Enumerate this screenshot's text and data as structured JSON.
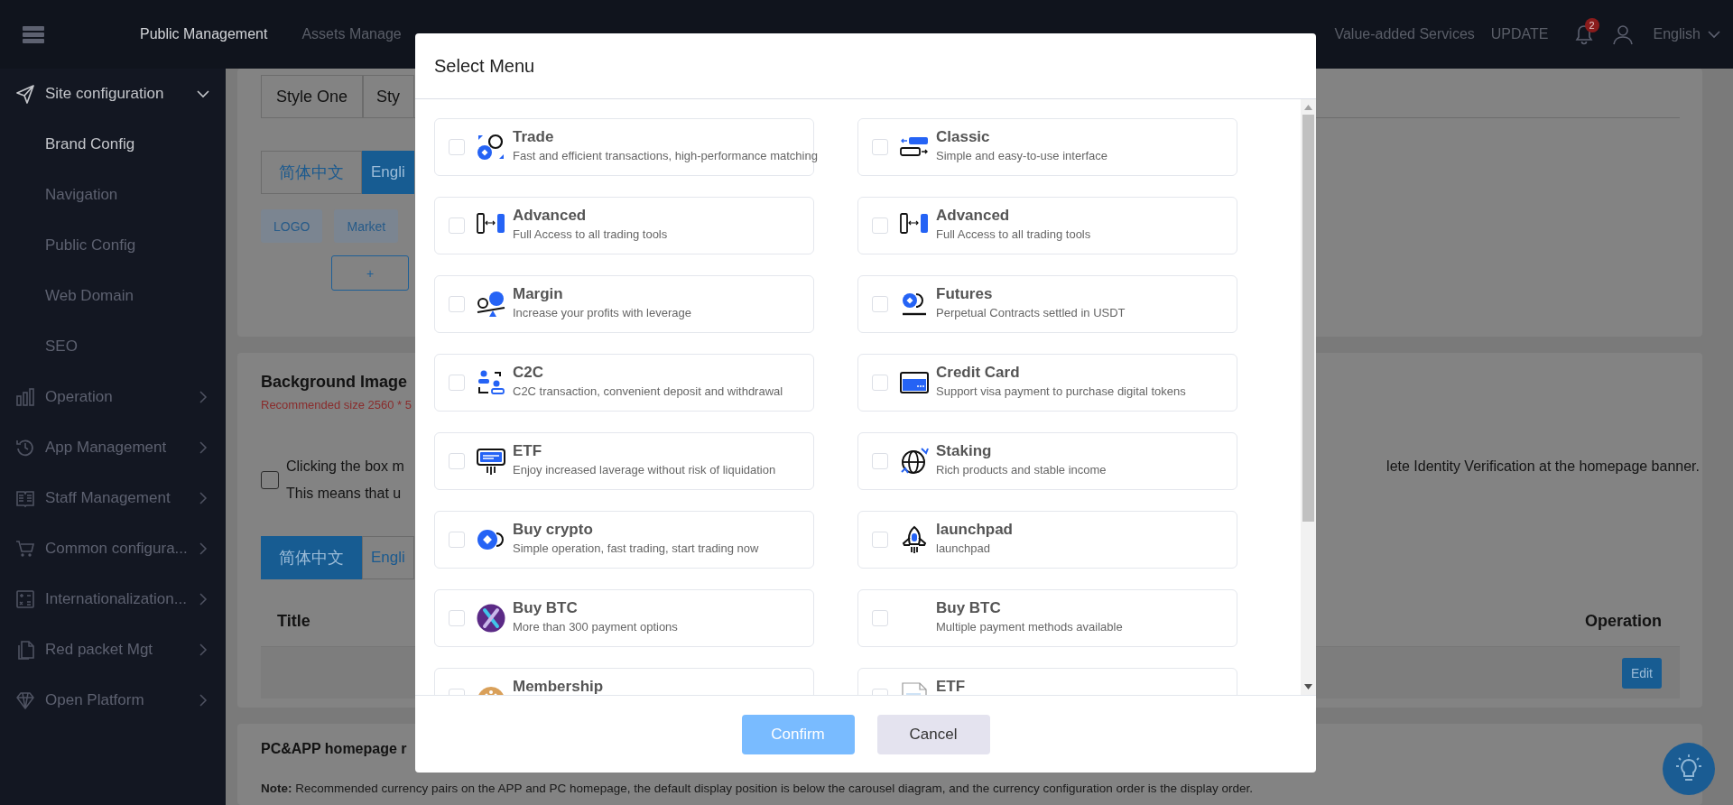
{
  "top_bar": {
    "nav": [
      {
        "label": "Public Management",
        "selected": true
      },
      {
        "label": "Assets Manage",
        "selected": false
      },
      {
        "label": "Value-added Services",
        "selected": false
      }
    ],
    "update_link": "UPDATE",
    "notification_count": "2",
    "language": "English"
  },
  "sidebar": {
    "items": [
      {
        "label": "Site configuration",
        "selected": false,
        "expanded": true,
        "children": [
          {
            "label": "Brand Config",
            "selected": true
          },
          {
            "label": "Navigation",
            "selected": false
          },
          {
            "label": "Public Config",
            "selected": false
          },
          {
            "label": "Web Domain",
            "selected": false
          },
          {
            "label": "SEO",
            "selected": false
          }
        ]
      },
      {
        "label": "Operation",
        "selected": false,
        "expanded": false
      },
      {
        "label": "App Management",
        "selected": false,
        "expanded": false
      },
      {
        "label": "Staff Management",
        "selected": false,
        "expanded": false
      },
      {
        "label": "Common configura...",
        "selected": false,
        "expanded": false
      },
      {
        "label": "Internationalization...",
        "selected": false,
        "expanded": false
      },
      {
        "label": "Red packet Mgt",
        "selected": false,
        "expanded": false
      },
      {
        "label": "Open Platform",
        "selected": false,
        "expanded": false
      }
    ]
  },
  "content": {
    "style_tabs": [
      {
        "label": "Style One"
      },
      {
        "label": "Sty"
      }
    ],
    "language_tabs": [
      {
        "label": "简体中文",
        "selected": false
      },
      {
        "label": "Engli",
        "selected": true
      }
    ],
    "chips": [
      "LOGO",
      "Market"
    ],
    "add_button": "+",
    "background": {
      "title": "Background Image",
      "hint": "Recommended size 2560 * 5",
      "notice": {
        "checked": false,
        "line_1_start": "Clicking the box m",
        "line_1_end": "lete Identity Verification at the homepage banner.",
        "line_2_start": "This means that u"
      },
      "language_tabs": [
        {
          "label": "简体中文",
          "selected": true
        },
        {
          "label": "Engli",
          "selected": false
        }
      ],
      "table": {
        "columns": [
          "Title",
          "Operation"
        ],
        "rows": [
          {
            "operation": "Edit"
          }
        ]
      }
    },
    "homepage": {
      "title": "PC&APP homepage r",
      "note": "**Note:** Recommended currency pairs on the APP and PC homepage, the default display position is below the carousel diagram, and the currency configuration order is the display order."
    }
  },
  "modal": {
    "title": "Select Menu",
    "options": [
      {
        "title": "Trade",
        "description": "Fast and efficient transactions, high-performance matching",
        "checked": false
      },
      {
        "title": "Classic",
        "description": "Simple and easy-to-use interface",
        "checked": false
      },
      {
        "title": "Advanced",
        "description": "Full Access to all trading tools",
        "checked": false
      },
      {
        "title": "Advanced",
        "description": "Full Access to all trading tools",
        "checked": false
      },
      {
        "title": "Margin",
        "description": "Increase your profits with leverage",
        "checked": false
      },
      {
        "title": "Futures",
        "description": "Perpetual Contracts settled in USDT",
        "checked": false
      },
      {
        "title": "C2C",
        "description": "C2C transaction, convenient deposit and withdrawal",
        "checked": false
      },
      {
        "title": "Credit Card",
        "description": "Support visa payment to purchase digital tokens",
        "checked": false
      },
      {
        "title": "ETF",
        "description": "Enjoy increased laverage without risk of liquidation",
        "checked": false
      },
      {
        "title": "Staking",
        "description": "Rich products and stable income",
        "checked": false
      },
      {
        "title": "Buy crypto",
        "description": "Simple operation, fast trading, start trading now",
        "checked": false
      },
      {
        "title": "launchpad",
        "description": "launchpad",
        "checked": false
      },
      {
        "title": "Buy BTC",
        "description": "More than 300 payment options",
        "checked": false
      },
      {
        "title": "Buy BTC",
        "description": "Multiple payment methods available",
        "checked": false
      },
      {
        "title": "Membership",
        "checked": false
      },
      {
        "title": "ETF",
        "checked": false
      }
    ],
    "buttons": [
      {
        "label": "Confirm",
        "kind": "primary"
      },
      {
        "label": "Cancel",
        "kind": "secondary"
      }
    ]
  }
}
